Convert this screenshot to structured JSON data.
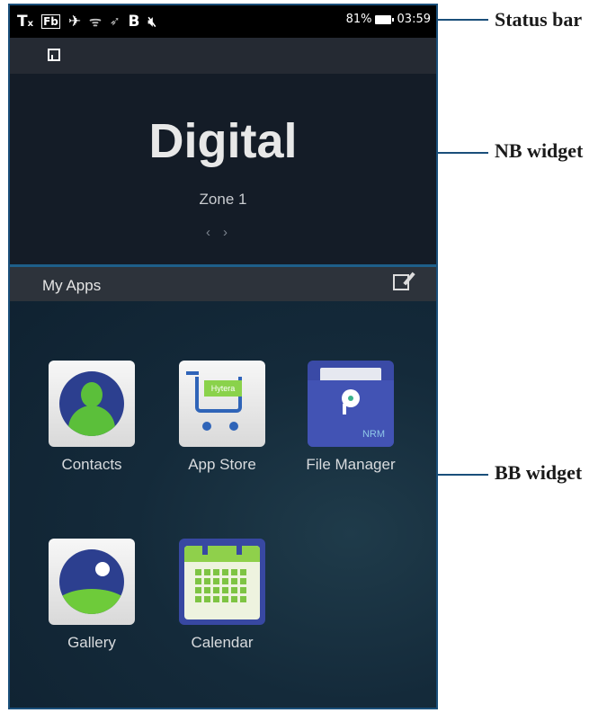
{
  "status_bar": {
    "icons": [
      "signal-none-icon",
      "fb-icon",
      "airplane-icon",
      "wifi-icon",
      "location-icon",
      "bluetooth-icon",
      "mute-icon",
      "battery-icon"
    ],
    "battery_percent": "81%",
    "time": "03:59"
  },
  "nb_widget": {
    "mode": "Digital",
    "zone": "Zone 1",
    "prev_arrow": "‹",
    "next_arrow": "›"
  },
  "bb_widget": {
    "title": "My Apps",
    "apps": [
      {
        "label": "Contacts",
        "icon": "contacts-icon"
      },
      {
        "label": "App Store",
        "icon": "app-store-icon",
        "badge": "Hytera"
      },
      {
        "label": "File Manager",
        "icon": "file-manager-icon",
        "badge": "NRM"
      },
      {
        "label": "Gallery",
        "icon": "gallery-icon"
      },
      {
        "label": "Calendar",
        "icon": "calendar-icon"
      }
    ]
  },
  "callouts": {
    "status_bar": "Status bar",
    "nb_widget": "NB widget",
    "bb_widget": "BB widget"
  },
  "colors": {
    "frame_border": "#1a4f7a",
    "nb_background": "#141c27",
    "bb_background": "#142a3a"
  }
}
